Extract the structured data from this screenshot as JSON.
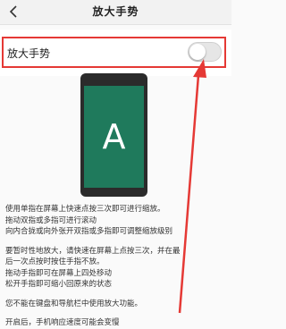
{
  "header": {
    "back_icon": "chevron-left-icon",
    "title": "放大手势"
  },
  "setting": {
    "label": "放大手势",
    "toggle_on": false
  },
  "illustration": {
    "letter": "A",
    "screen_color": "#1f7a5c"
  },
  "annotation": {
    "color": "#e53935"
  },
  "instructions": {
    "p1": [
      "使用单指在屏幕上快速点按三次即可进行缩放。",
      "拖动双指或多指可进行滚动",
      "向内合拢或向外张开双指或多指即可调整缩放级别"
    ],
    "p2": [
      "要暂时性地放大，请快速在屏幕上点按三次，并在最",
      "后一次点按时按住手指不放。",
      "拖动手指即可在屏幕上四处移动",
      "松开手指即可缩小回原来的状态"
    ],
    "p3": [
      "您不能在键盘和导航栏中使用放大功能。"
    ],
    "p4": [
      "开启后，手机响应速度可能会变慢"
    ]
  }
}
